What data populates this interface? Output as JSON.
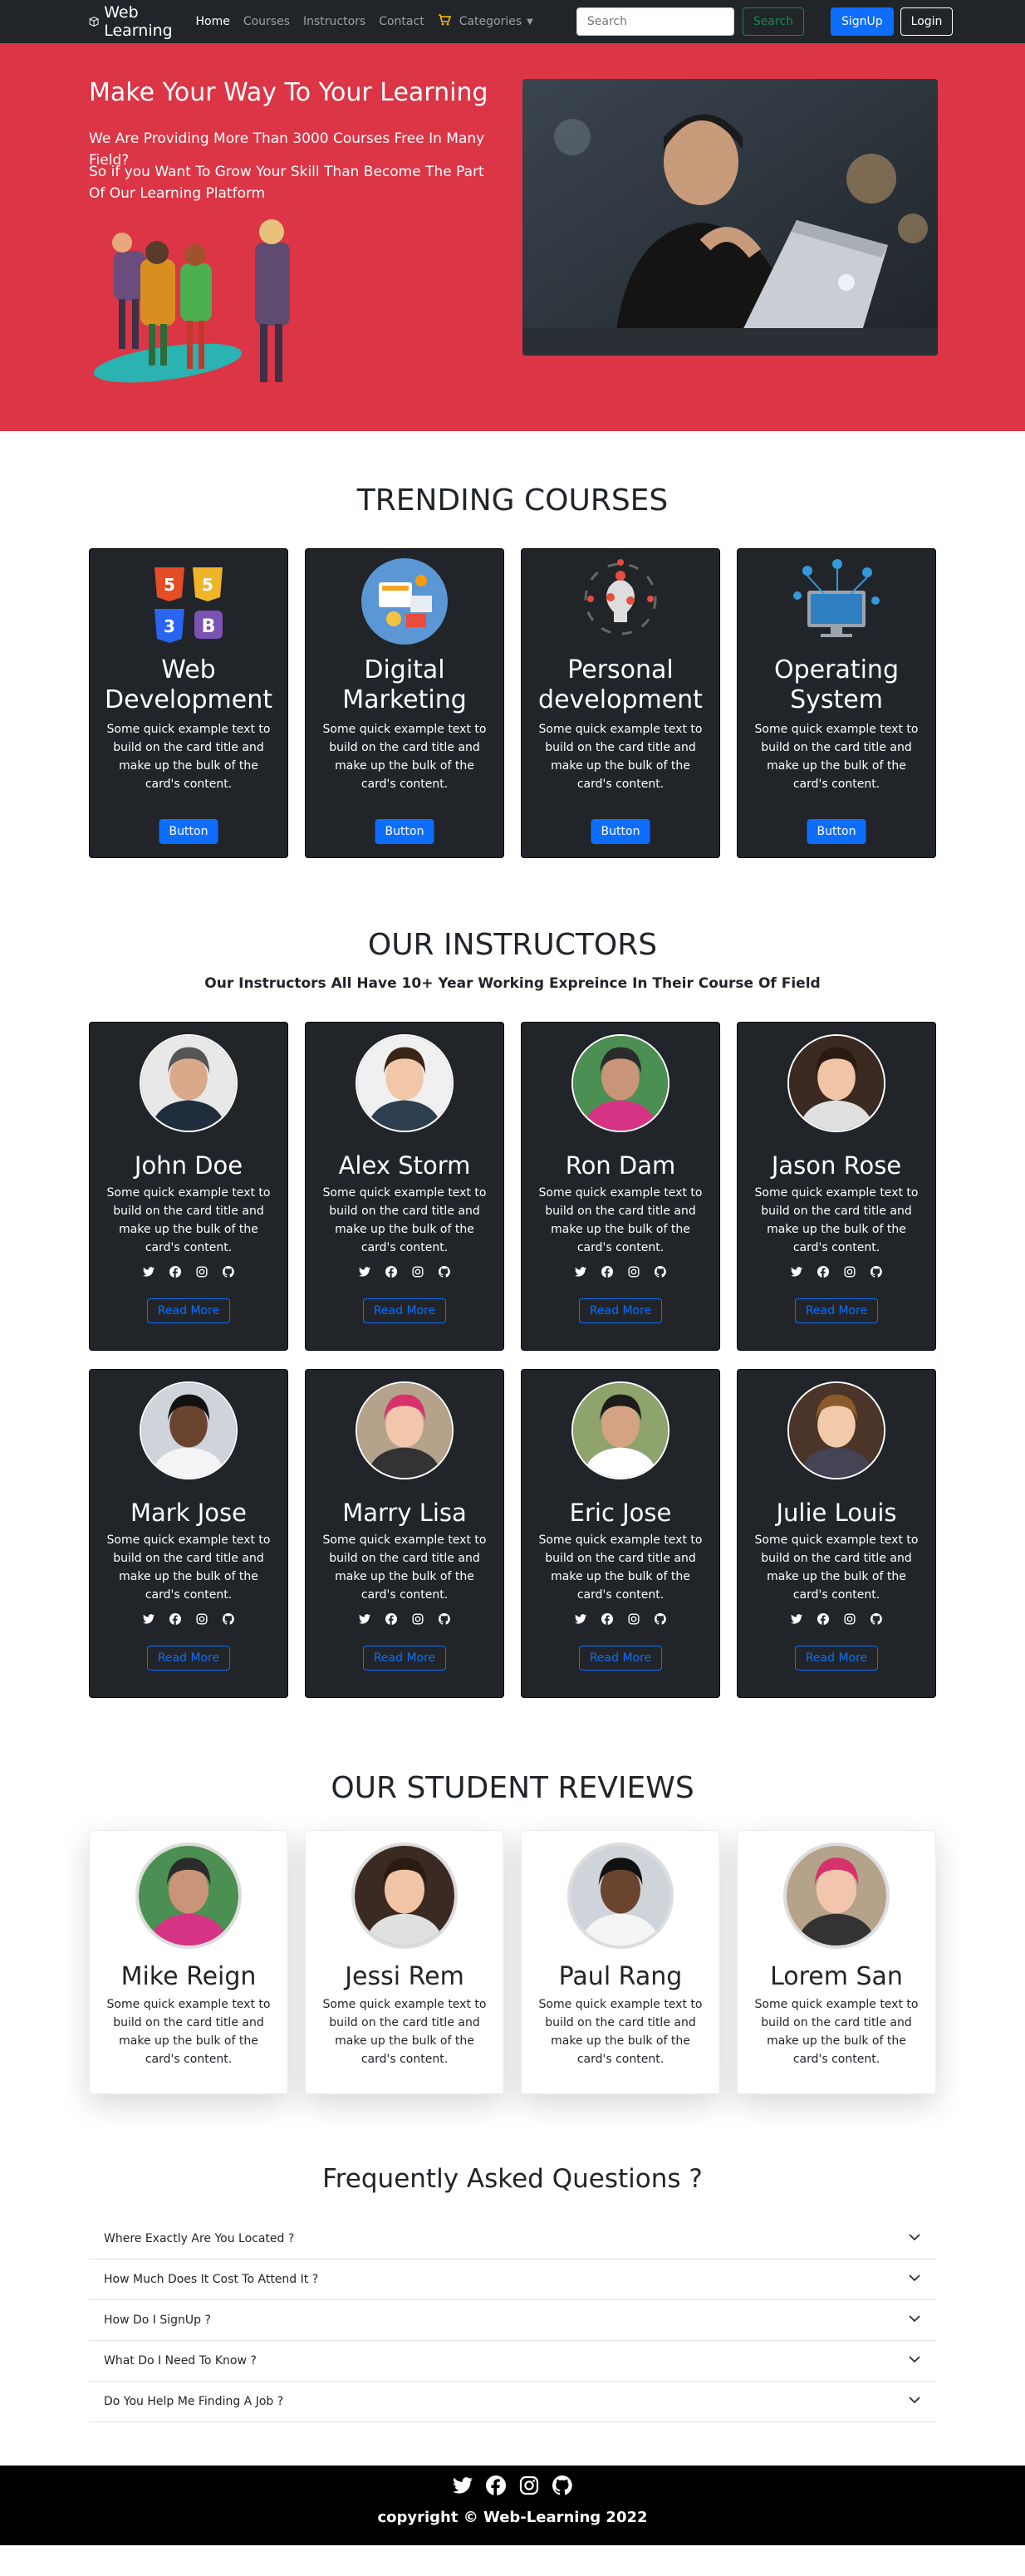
{
  "nav": {
    "brand": "Web Learning",
    "links": [
      "Home",
      "Courses",
      "Instructors",
      "Contact"
    ],
    "categories": "Categories",
    "search_placeholder": "Search",
    "search_button": "Search",
    "signup": "SignUp",
    "login": "Login"
  },
  "hero": {
    "title": "Make Your Way To Your Learning",
    "line1": "We Are Providing More Than 3000 Courses Free In Many Field?",
    "line2": "So if you Want To Grow Your Skill Than Become The Part Of Our Learning Platform"
  },
  "courses": {
    "title": "TRENDING COURSES",
    "items": [
      {
        "title": "Web Development",
        "text": "Some quick example text to build on the card title and make up the bulk of the card's content.",
        "button": "Button",
        "icon": "html-css-js-bootstrap-icons"
      },
      {
        "title": "Digital Marketing",
        "text": "Some quick example text to build on the card title and make up the bulk of the card's content.",
        "button": "Button",
        "icon": "digital-marketing-icon"
      },
      {
        "title": "Personal development",
        "text": "Some quick example text to build on the card title and make up the bulk of the card's content.",
        "button": "Button",
        "icon": "personal-development-icon"
      },
      {
        "title": "Operating System",
        "text": "Some quick example text to build on the card title and make up the bulk of the card's content.",
        "button": "Button",
        "icon": "operating-system-icon"
      }
    ]
  },
  "instructors": {
    "title": "OUR INSTRUCTORS",
    "subtitle": "Our Instructors All Have 10+ Year Working Expreince In Their Course Of Field",
    "read_more": "Read More",
    "text": "Some quick example text to build on the card title and make up the bulk of the card's content.",
    "items": [
      {
        "name": "John Doe"
      },
      {
        "name": "Alex Storm"
      },
      {
        "name": "Ron Dam"
      },
      {
        "name": "Jason Rose"
      },
      {
        "name": "Mark Jose"
      },
      {
        "name": "Marry Lisa"
      },
      {
        "name": "Eric Jose"
      },
      {
        "name": "Julie Louis"
      }
    ]
  },
  "reviews": {
    "title": "OUR STUDENT REVIEWS",
    "text": "Some quick example text to build on the card title and make up the bulk of the card's content.",
    "items": [
      {
        "name": "Mike Reign"
      },
      {
        "name": "Jessi Rem"
      },
      {
        "name": "Paul Rang"
      },
      {
        "name": "Lorem San"
      }
    ]
  },
  "faq": {
    "title": "Frequently Asked Questions ?",
    "items": [
      "Where Exactly Are You Located ?",
      "How Much Does It Cost To Attend It ?",
      "How Do I SignUp ?",
      "What Do I Need To Know ?",
      "Do You Help Me Finding A Job ?"
    ]
  },
  "footer": {
    "copyright": "copyright © Web-Learning 2022"
  },
  "colors": {
    "hero_bg": "#dc3545",
    "dark": "#212529",
    "primary": "#0d6efd",
    "success": "#198754"
  }
}
